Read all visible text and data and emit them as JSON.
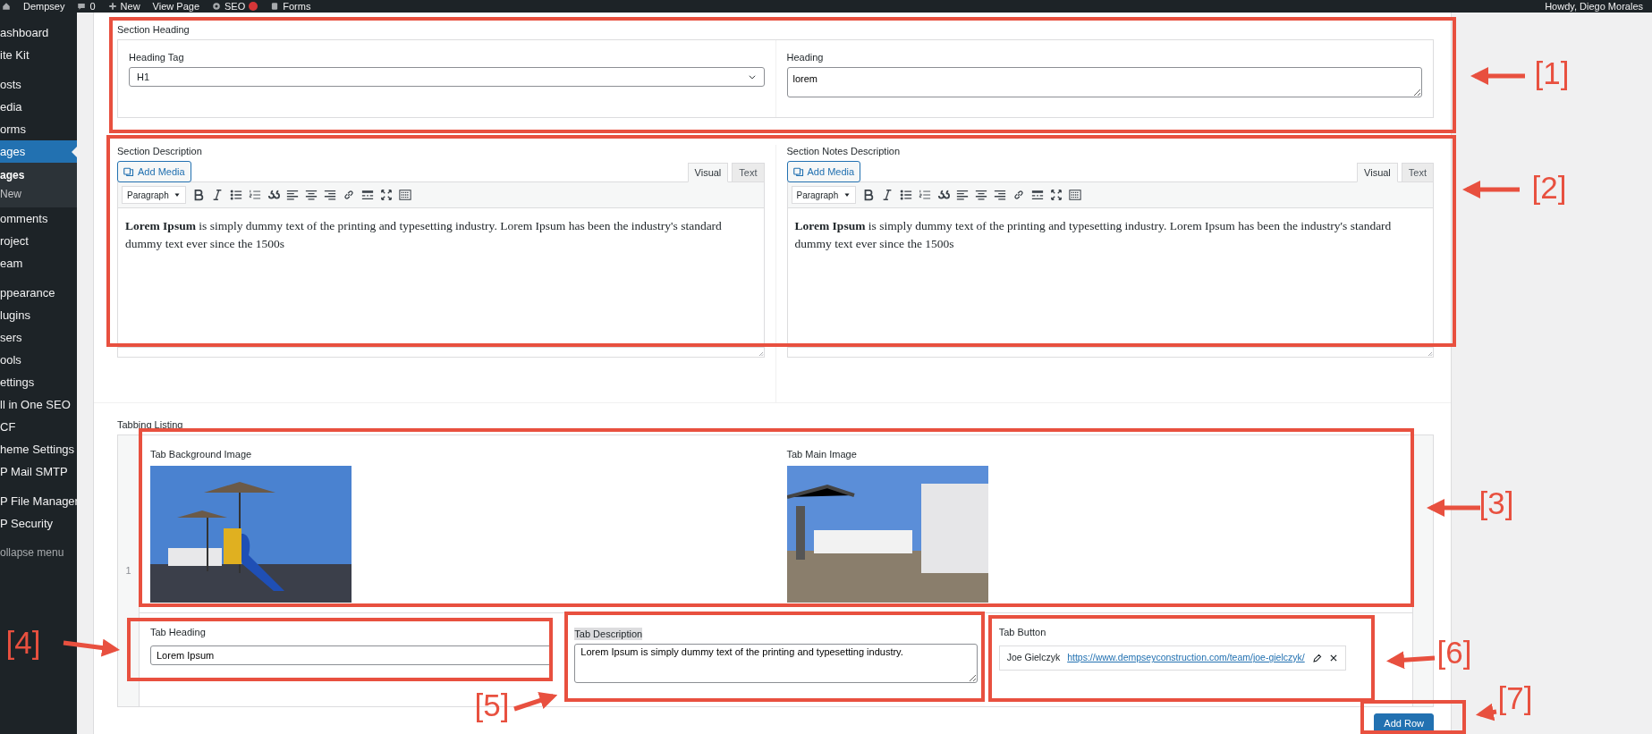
{
  "admin_bar": {
    "site": "Dempsey",
    "comments": "0",
    "new": "New",
    "view_page": "View Page",
    "seo": "SEO",
    "forms": "Forms",
    "greeting": "Howdy, Diego Morales"
  },
  "sidebar": {
    "groups": [
      {
        "items": [
          {
            "label": "ashboard",
            "selected": false
          },
          {
            "label": "ite Kit",
            "selected": false
          }
        ]
      },
      {
        "items": [
          {
            "label": "osts",
            "selected": false
          },
          {
            "label": "edia",
            "selected": false
          },
          {
            "label": "orms",
            "selected": false
          },
          {
            "label": "ages",
            "selected": true,
            "children": [
              {
                "label": "ages",
                "selected": true
              },
              {
                "label": "New",
                "selected": false
              }
            ]
          },
          {
            "label": "omments",
            "selected": false
          },
          {
            "label": "roject",
            "selected": false
          },
          {
            "label": "eam",
            "selected": false
          }
        ]
      },
      {
        "items": [
          {
            "label": "ppearance",
            "selected": false
          },
          {
            "label": "lugins",
            "selected": false
          },
          {
            "label": "sers",
            "selected": false
          },
          {
            "label": "ools",
            "selected": false
          },
          {
            "label": "ettings",
            "selected": false
          },
          {
            "label": "ll in One SEO",
            "selected": false
          },
          {
            "label": "CF",
            "selected": false
          },
          {
            "label": "heme Settings",
            "selected": false
          },
          {
            "label": "P Mail SMTP",
            "selected": false
          }
        ]
      },
      {
        "items": [
          {
            "label": "P File Manager",
            "selected": false
          },
          {
            "label": "P Security",
            "selected": false
          }
        ]
      }
    ],
    "collapse": "ollapse menu"
  },
  "section_heading": {
    "title": "Section Heading",
    "heading_tag": {
      "label": "Heading Tag",
      "value": "H1"
    },
    "heading": {
      "label": "Heading",
      "value": "lorem"
    }
  },
  "editors": [
    {
      "label": "Section Description",
      "add_media": "Add Media",
      "tabs": [
        {
          "label": "Visual",
          "selected": true
        },
        {
          "label": "Text",
          "selected": false
        }
      ],
      "format": "Paragraph",
      "content": "**Lorem Ipsum** is simply dummy text of the printing and typesetting industry. Lorem Ipsum has been the industry's standard dummy text ever since the 1500s"
    },
    {
      "label": "Section Notes Description",
      "add_media": "Add Media",
      "tabs": [
        {
          "label": "Visual",
          "selected": true
        },
        {
          "label": "Text",
          "selected": false
        }
      ],
      "format": "Paragraph",
      "content": "**Lorem Ipsum** is simply dummy text of the printing and typesetting industry. Lorem Ipsum has been the industry's standard dummy text ever since the 1500s"
    }
  ],
  "tabbing": {
    "title": "Tabbing Listing",
    "rows": [
      {
        "number": "1",
        "background_image": {
          "label": "Tab Background Image"
        },
        "main_image": {
          "label": "Tab Main Image"
        },
        "tab_heading": {
          "label": "Tab Heading",
          "value": "Lorem Ipsum"
        },
        "tab_description": {
          "label": "Tab Description",
          "highlighted": true,
          "value": "Lorem Ipsum is simply dummy text of the printing and typesetting industry."
        },
        "tab_button": {
          "label": "Tab Button",
          "title": "Joe Gielczyk",
          "url": "https://www.dempseyconstruction.com/team/joe-gielczyk/"
        }
      }
    ],
    "add_row": "Add Row"
  },
  "annotations": [
    {
      "label": "[1]"
    },
    {
      "label": "[2]"
    },
    {
      "label": "[3]"
    },
    {
      "label": "[4]"
    },
    {
      "label": "[5]"
    },
    {
      "label": "[6]"
    },
    {
      "label": "[7]"
    }
  ]
}
